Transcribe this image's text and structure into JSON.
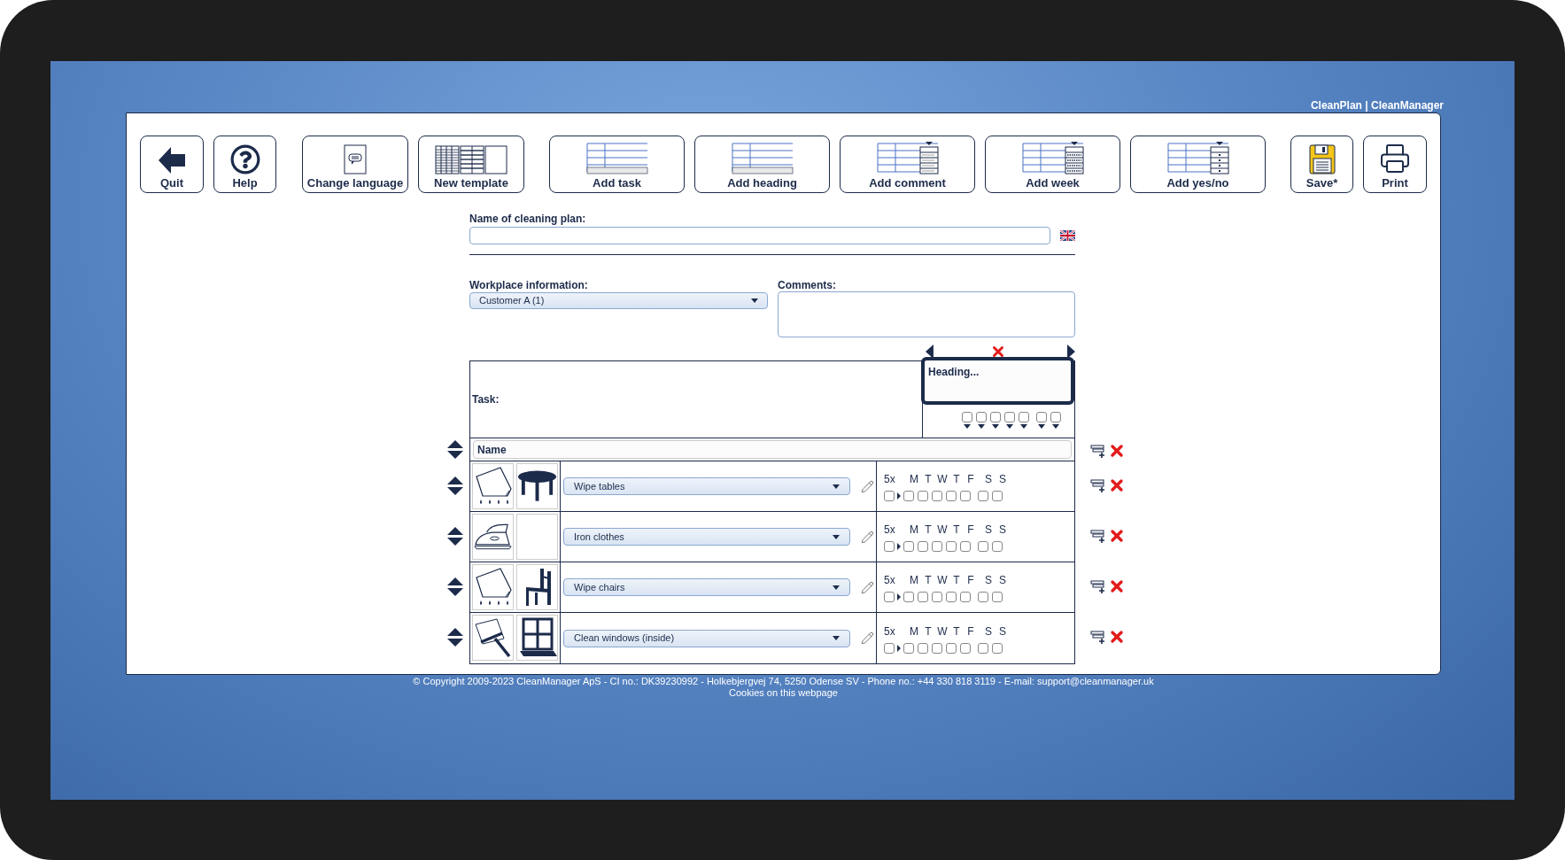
{
  "header": {
    "brand": "CleanPlan | CleanManager"
  },
  "toolbar": [
    {
      "label": "Quit",
      "kind": "quit"
    },
    {
      "label": "Help",
      "kind": "help"
    },
    {
      "label": "Change language",
      "kind": "language"
    },
    {
      "label": "New template",
      "kind": "template"
    },
    {
      "label": "Add task",
      "kind": "task"
    },
    {
      "label": "Add heading",
      "kind": "heading"
    },
    {
      "label": "Add comment",
      "kind": "comment"
    },
    {
      "label": "Add week",
      "kind": "week"
    },
    {
      "label": "Add yes/no",
      "kind": "yesno"
    },
    {
      "label": "Save*",
      "kind": "save"
    },
    {
      "label": "Print",
      "kind": "print"
    }
  ],
  "form": {
    "name_label": "Name of cleaning plan:",
    "workplace_label": "Workplace information:",
    "workplace_value": "Customer A (1)",
    "comments_label": "Comments:"
  },
  "table": {
    "task_label": "Task:",
    "heading_placeholder": "Heading...",
    "name_value": "Name",
    "header_days": [
      {
        "checked": false
      },
      {
        "checked": false
      },
      {
        "checked": false
      },
      {
        "checked": false
      },
      {
        "checked": false
      },
      {
        "checked": false
      },
      {
        "checked": false
      }
    ],
    "rows": [
      {
        "task": "Wipe tables",
        "pictures": [
          {
            "kind": "cloth"
          },
          {
            "kind": "table"
          }
        ],
        "frequency": "5x",
        "frequency_checked": false,
        "days": [
          {
            "label": "M",
            "checked": false
          },
          {
            "label": "T",
            "checked": false
          },
          {
            "label": "W",
            "checked": false
          },
          {
            "label": "T",
            "checked": false
          },
          {
            "label": "F",
            "checked": false
          },
          {
            "label": "S",
            "checked": false
          },
          {
            "label": "S",
            "checked": false
          }
        ]
      },
      {
        "task": "Iron clothes",
        "pictures": [
          {
            "kind": "iron"
          },
          {
            "kind": "empty"
          }
        ],
        "frequency": "5x",
        "frequency_checked": false,
        "days": [
          {
            "label": "M",
            "checked": false
          },
          {
            "label": "T",
            "checked": false
          },
          {
            "label": "W",
            "checked": false
          },
          {
            "label": "T",
            "checked": false
          },
          {
            "label": "F",
            "checked": false
          },
          {
            "label": "S",
            "checked": false
          },
          {
            "label": "S",
            "checked": false
          }
        ]
      },
      {
        "task": "Wipe chairs",
        "pictures": [
          {
            "kind": "cloth"
          },
          {
            "kind": "chair"
          }
        ],
        "frequency": "5x",
        "frequency_checked": false,
        "days": [
          {
            "label": "M",
            "checked": false
          },
          {
            "label": "T",
            "checked": false
          },
          {
            "label": "W",
            "checked": false
          },
          {
            "label": "T",
            "checked": false
          },
          {
            "label": "F",
            "checked": false
          },
          {
            "label": "S",
            "checked": false
          },
          {
            "label": "S",
            "checked": false
          }
        ]
      },
      {
        "task": "Clean windows (inside)",
        "pictures": [
          {
            "kind": "squeegee"
          },
          {
            "kind": "window"
          }
        ],
        "frequency": "5x",
        "frequency_checked": false,
        "days": [
          {
            "label": "M",
            "checked": false
          },
          {
            "label": "T",
            "checked": false
          },
          {
            "label": "W",
            "checked": false
          },
          {
            "label": "T",
            "checked": false
          },
          {
            "label": "F",
            "checked": false
          },
          {
            "label": "S",
            "checked": false
          },
          {
            "label": "S",
            "checked": false
          }
        ]
      }
    ]
  },
  "footer": {
    "copyright": "© Copyright 2009-2023 CleanManager ApS - CI no.: DK39230992 - Holkebjergvej 74, 5250 Odense SV - Phone no.: +44 330 818 3119 - E-mail: support@cleanmanager.uk",
    "cookies_link": "Cookies on this webpage"
  }
}
